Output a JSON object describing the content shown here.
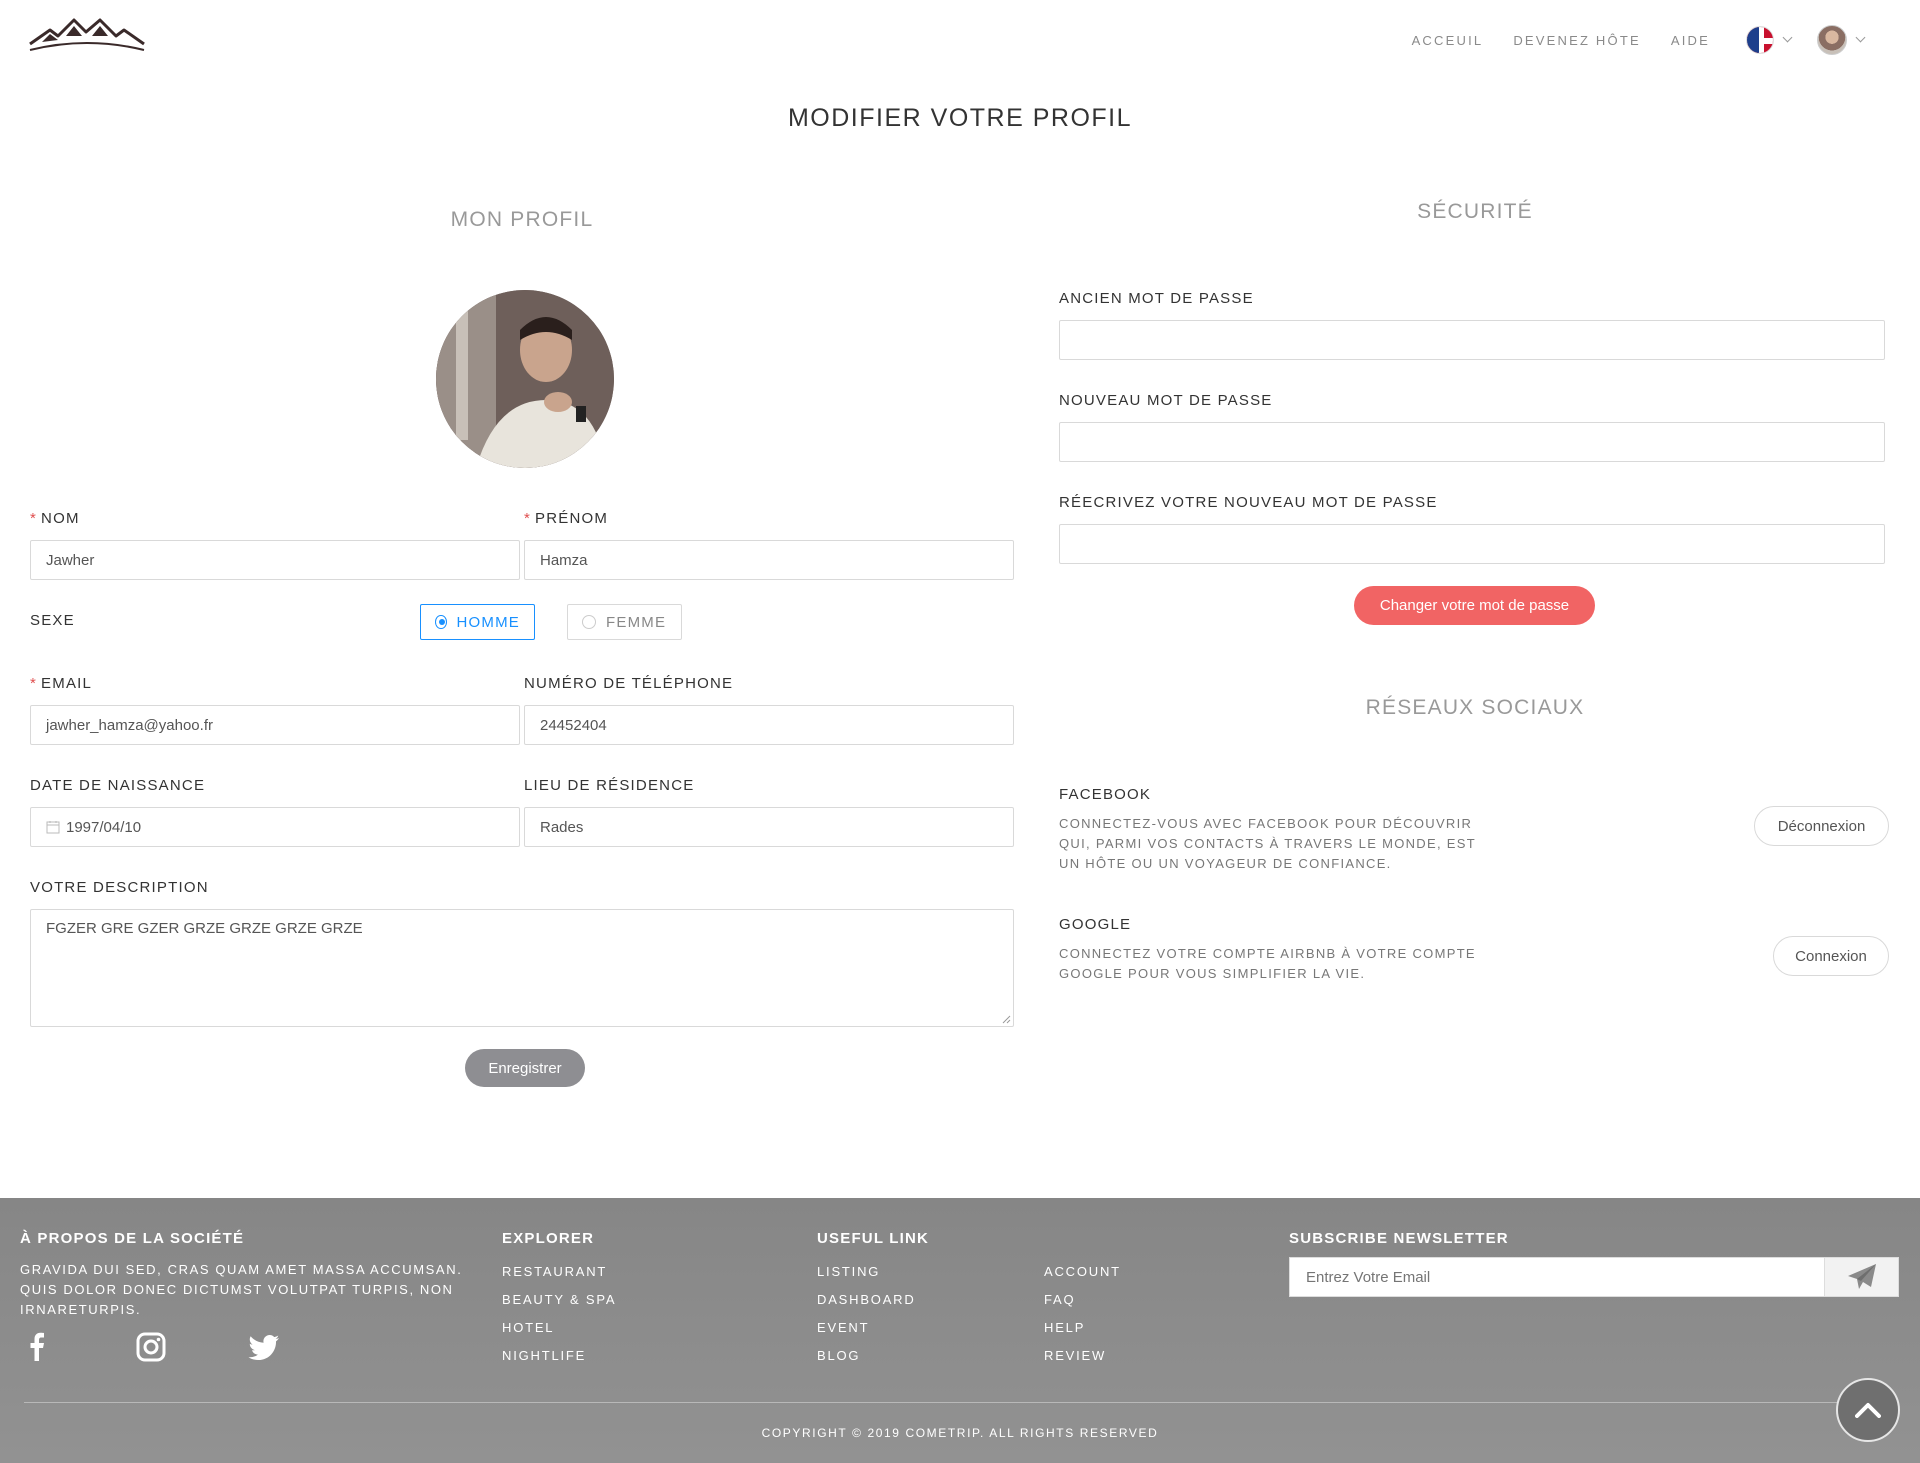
{
  "header": {
    "nav": [
      "ACCEUIL",
      "DEVENEZ HÔTE",
      "AIDE"
    ]
  },
  "page_title": "MODIFIER VOTRE PROFIL",
  "profile": {
    "section_title": "MON PROFIL",
    "nom_label": "NOM",
    "nom_value": "Jawher",
    "prenom_label": "PRÉNOM",
    "prenom_value": "Hamza",
    "sexe_label": "SEXE",
    "sexe_options": [
      "HOMME",
      "FEMME"
    ],
    "sexe_selected": "HOMME",
    "email_label": "EMAIL",
    "email_value": "jawher_hamza@yahoo.fr",
    "phone_label": "NUMÉRO DE TÉLÉPHONE",
    "phone_value": "24452404",
    "birth_label": "DATE DE NAISSANCE",
    "birth_value": "1997/04/10",
    "residence_label": "LIEU DE RÉSIDENCE",
    "residence_value": "Rades",
    "description_label": "VOTRE DESCRIPTION",
    "description_value": "FGZER GRE GZER GRZE GRZE GRZE GRZE",
    "save_button": "Enregistrer"
  },
  "security": {
    "section_title": "SÉCURITÉ",
    "old_password_label": "ANCIEN MOT DE PASSE",
    "new_password_label": "NOUVEAU MOT DE PASSE",
    "confirm_password_label": "RÉECRIVEZ VOTRE NOUVEAU MOT DE PASSE",
    "change_button": "Changer votre mot de passe"
  },
  "social": {
    "section_title": "RÉSEAUX SOCIAUX",
    "facebook_title": "FACEBOOK",
    "facebook_desc": "CONNECTEZ-VOUS AVEC FACEBOOK POUR DÉCOUVRIR QUI, PARMI VOS CONTACTS À TRAVERS LE MONDE, EST UN HÔTE OU UN VOYAGEUR DE CONFIANCE.",
    "facebook_button": "Déconnexion",
    "google_title": "GOOGLE",
    "google_desc": "CONNECTEZ VOTRE COMPTE AIRBNB À VOTRE COMPTE GOOGLE POUR VOUS SIMPLIFIER LA VIE.",
    "google_button": "Connexion"
  },
  "footer": {
    "about_title": "À PROPOS DE LA SOCIÉTÉ",
    "about_text": "GRAVIDA DUI SED, CRAS QUAM AMET MASSA ACCUMSAN. QUIS DOLOR DONEC DICTUMST VOLUTPAT TURPIS, NON IRNARETURPIS.",
    "explorer_title": "EXPLORER",
    "explorer_links": [
      "RESTAURANT",
      "BEAUTY & SPA",
      "HOTEL",
      "NIGHTLIFE"
    ],
    "useful_title": "USEFUL LINK",
    "useful_links_1": [
      "LISTING",
      "DASHBOARD",
      "EVENT",
      "BLOG"
    ],
    "useful_links_2": [
      "ACCOUNT",
      "FAQ",
      "HELP",
      "REVIEW"
    ],
    "newsletter_title": "SUBSCRIBE NEWSLETTER",
    "newsletter_placeholder": "Entrez Votre Email",
    "copyright": "COPYRIGHT © 2019 COMETRIP. ALL RIGHTS RESERVED"
  },
  "icons": [
    "logo-mountains",
    "flag-uk-icon",
    "chevron-down-icon",
    "avatar",
    "calendar-icon",
    "facebook-icon",
    "instagram-icon",
    "twitter-icon",
    "paper-plane-icon",
    "chevron-up-icon"
  ],
  "colors": {
    "accent_red": "#f16464",
    "radio_blue": "#1890ff",
    "save_gray": "#8e8e92",
    "footer_gray": "#8c8c8c"
  }
}
